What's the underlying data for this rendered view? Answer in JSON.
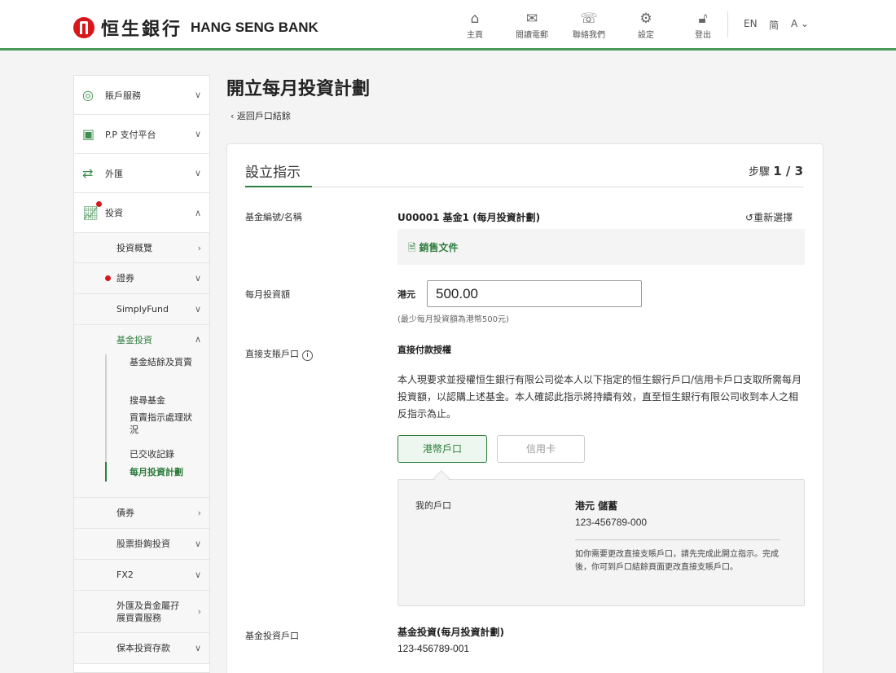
{
  "brand": {
    "name_cn": "恒生銀行",
    "name_en": "HANG SENG BANK",
    "accent": "#2e7d3e",
    "logo_color": "#d8161b"
  },
  "topnav": [
    {
      "label": "主頁",
      "icon": "home-icon"
    },
    {
      "label": "閱讀電郵",
      "icon": "mail-icon"
    },
    {
      "label": "聯絡我們",
      "icon": "phone-icon"
    },
    {
      "label": "設定",
      "icon": "gear-icon"
    },
    {
      "label": "登出",
      "icon": "lock-icon"
    }
  ],
  "lang": {
    "en": "EN",
    "sc": "简",
    "font": "A"
  },
  "sidebar": {
    "items": [
      {
        "label": "賬戶服務",
        "icon": "user-circle-icon"
      },
      {
        "label": "P.P 支付平台",
        "icon": "payment-icon"
      },
      {
        "label": "外匯",
        "icon": "exchange-icon"
      },
      {
        "label": "投資",
        "icon": "invest-chart-icon"
      }
    ],
    "sub": [
      {
        "label": "投資概覽"
      },
      {
        "label": "證券"
      },
      {
        "label": "SimplyFund"
      },
      {
        "label": "基金投資"
      },
      {
        "label": "債券"
      },
      {
        "label": "股票掛鉤投資"
      },
      {
        "label": "FX2"
      },
      {
        "label": "外匯及貴金屬孖展買賣服務"
      },
      {
        "label": "保本投資存款"
      }
    ],
    "fund_items": [
      {
        "label": "基金結餘及買賣"
      },
      {
        "label": "搜尋基金"
      },
      {
        "label": "買賣指示處理狀況"
      },
      {
        "label": "已交收記錄"
      },
      {
        "label": "每月投資計劃"
      }
    ]
  },
  "page": {
    "title": "開立每月投資計劃",
    "back": "返回戶口結餘",
    "section_title": "設立指示",
    "step_prefix": "步驟",
    "step_value": "1 / 3"
  },
  "form": {
    "fund_label": "基金編號/名稱",
    "fund_value": "U00001 基金1 (每月投資計劃)",
    "reselect": "重新選擇",
    "doc_link": "銷售文件",
    "amount_label": "每月投資額",
    "currency": "港元",
    "amount_value": "500.00",
    "amount_hint": "(最少每月投資額為港幣500元)",
    "debit_label": "直接支賬戶口",
    "auth_title": "直接付款授權",
    "auth_text": "本人現要求並授權恒生銀行有限公司從本人以下指定的恒生銀行戶口/信用卡戶口支取所需每月投資額，以認購上述基金。本人確認此指示將持續有效，直至恒生銀行有限公司收到本人之相反指示為止。",
    "tab_hkd": "港幣戶口",
    "tab_card": "信用卡",
    "my_account_label": "我的戶口",
    "account_type": "港元 儲蓄",
    "account_no": "123-456789-000",
    "account_note": "如你需要更改直接支賬戶口，請先完成此開立指示。完成後，你可到戶口結餘頁面更改直接支賬戶口。",
    "fund_acct_label": "基金投資戶口",
    "fund_acct_name": "基金投資(每月投資計劃)",
    "fund_acct_no": "123-456789-001"
  }
}
